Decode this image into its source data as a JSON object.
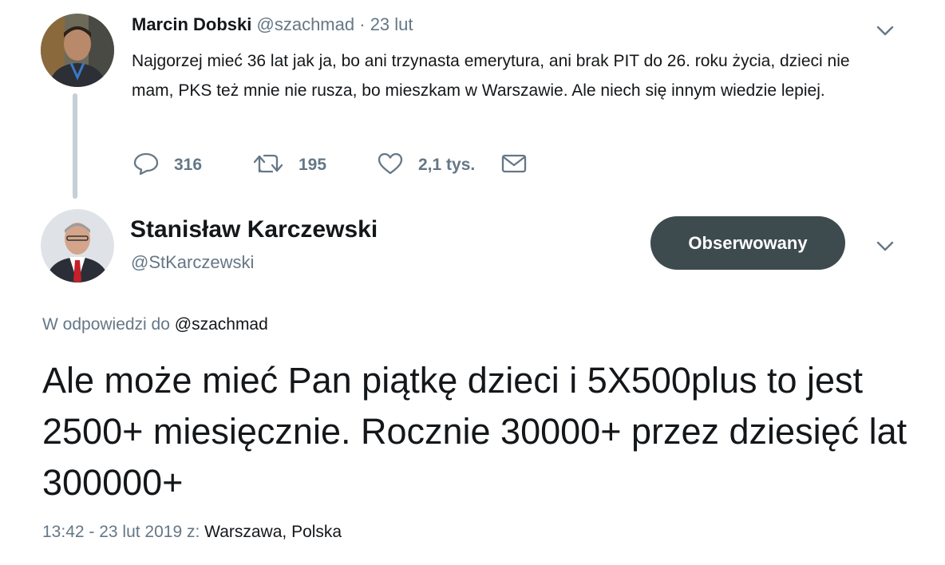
{
  "parent_tweet": {
    "name": "Marcin Dobski",
    "handle": "@szachmad",
    "separator": "·",
    "date": "23 lut",
    "text": "Najgorzej mieć 36 lat jak ja, bo ani trzynasta emerytura, ani brak PIT do 26. roku życia, dzieci nie mam, PKS też mnie nie rusza, bo mieszkam w Warszawie. Ale niech się innym wiedzie lepiej.",
    "actions": {
      "reply": {
        "icon": "speech-bubble-icon",
        "count": "316"
      },
      "retweet": {
        "icon": "retweet-arrows-icon",
        "count": "195"
      },
      "like": {
        "icon": "heart-icon",
        "count": "2,1 tys."
      },
      "dm": {
        "icon": "envelope-icon"
      }
    }
  },
  "main_tweet": {
    "name": "Stanisław Karczewski",
    "handle": "@StKarczewski",
    "follow_label": "Obserwowany",
    "reply_prefix": "W odpowiedzi do",
    "reply_to": "@szachmad",
    "text": "Ale może mieć Pan piątkę dzieci i 5X500plus to jest 2500+ miesięcznie. Rocznie 30000+ przez dziesięć lat 300000+",
    "time": "13:42 - 23 lut 2019 z:",
    "place": "Warszawa, Polska"
  },
  "colors": {
    "muted": "#657786",
    "text": "#14171a",
    "follow_button": "#3d4b4f",
    "thread_line": "#c4cfd6"
  }
}
